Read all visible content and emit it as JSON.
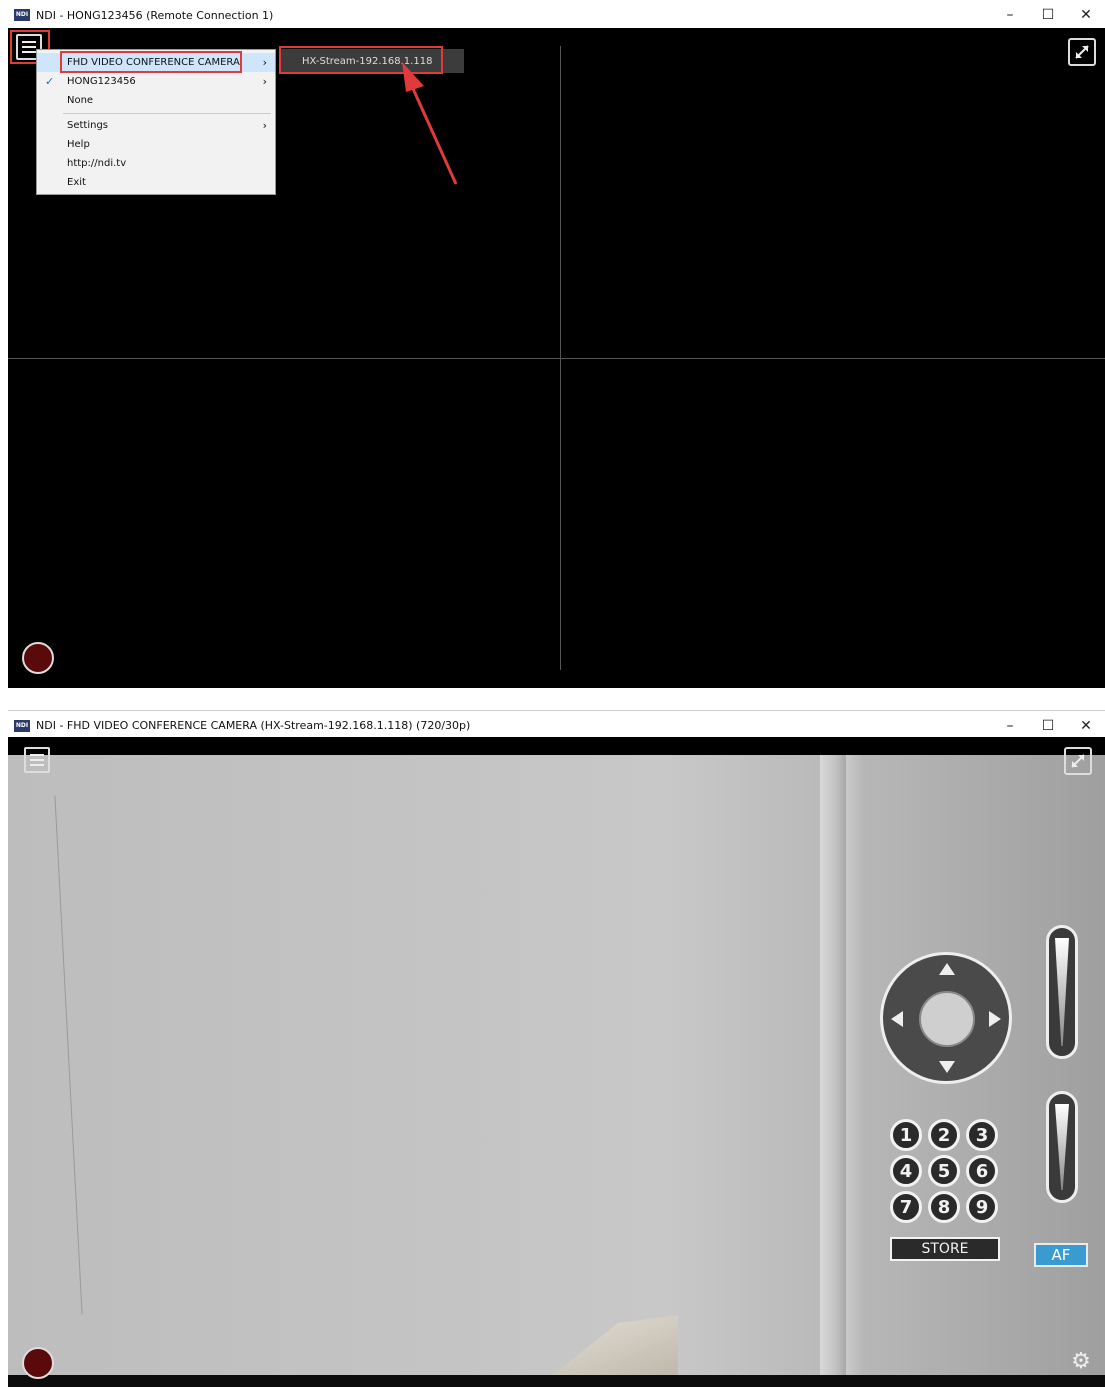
{
  "window1": {
    "title": "NDI - HONG123456 (Remote Connection 1)",
    "logo": "NDI",
    "controls": {
      "minimize": "–",
      "maximize": "☐",
      "close": "✕"
    },
    "menu": {
      "items": [
        {
          "label": "FHD VIDEO CONFERENCE CAMERA",
          "arrow": "›",
          "active": true
        },
        {
          "label": "HONG123456",
          "arrow": "›",
          "checked": "✓"
        },
        {
          "label": "None"
        },
        {
          "label": "Settings",
          "arrow": "›"
        },
        {
          "label": "Help"
        },
        {
          "label": "http://ndi.tv"
        },
        {
          "label": "Exit"
        }
      ]
    },
    "submenu": {
      "label": "HX-Stream-192.168.1.118"
    },
    "annotation_color": "#e03a3a"
  },
  "window2": {
    "title": "NDI - FHD VIDEO CONFERENCE CAMERA (HX-Stream-192.168.1.118) (720/30p)",
    "logo": "NDI",
    "controls": {
      "minimize": "–",
      "maximize": "☐",
      "close": "✕"
    },
    "presets": [
      "1",
      "2",
      "3",
      "4",
      "5",
      "6",
      "7",
      "8",
      "9"
    ],
    "store_label": "STORE",
    "af_label": "AF",
    "af_color": "#3a9bd0",
    "gear_glyph": "⚙"
  }
}
